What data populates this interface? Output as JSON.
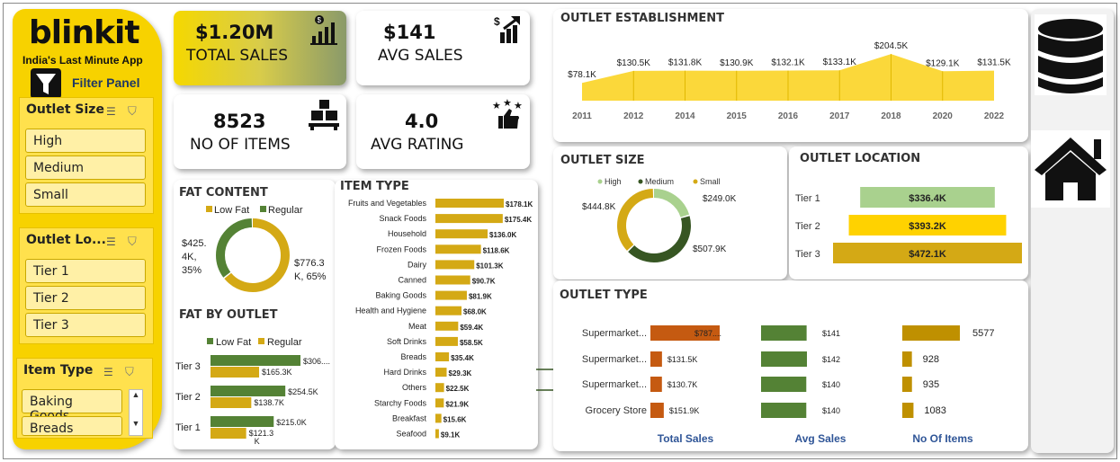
{
  "brand": {
    "logo": "blinkit",
    "tagline": "India's Last Minute App",
    "filter_panel": "Filter Panel"
  },
  "slicers": {
    "outlet_size": {
      "title": "Outlet Size",
      "items": [
        "High",
        "Medium",
        "Small"
      ]
    },
    "outlet_location": {
      "title": "Outlet Lo...",
      "items": [
        "Tier 1",
        "Tier 2",
        "Tier 3"
      ]
    },
    "item_type": {
      "title": "Item Type",
      "items": [
        "Baking Goods",
        "Breads"
      ]
    }
  },
  "kpis": {
    "total_sales": {
      "value": "$1.20M",
      "label": "TOTAL SALES"
    },
    "avg_sales": {
      "value": "$141",
      "label": "AVG SALES"
    },
    "no_of_items": {
      "value": "8523",
      "label": "NO OF ITEMS"
    },
    "avg_rating": {
      "value": "4.0",
      "label": "AVG RATING"
    }
  },
  "colors": {
    "yellow": "#f7d200",
    "gold": "#d4a915",
    "green": "#548235",
    "light_green": "#a9d18e",
    "dark_green": "#375623",
    "orange": "#c55a11",
    "dark_gold": "#bf9000"
  },
  "chart_data": [
    {
      "id": "outlet_establishment",
      "type": "area",
      "title": "OUTLET ESTABLISHMENT",
      "x": [
        "2011",
        "2012",
        "2014",
        "2015",
        "2016",
        "2017",
        "2018",
        "2020",
        "2022"
      ],
      "values": [
        78.1,
        130.5,
        131.8,
        130.9,
        132.1,
        133.1,
        204.5,
        129.1,
        131.5
      ],
      "labels": [
        "$78.1K",
        "$130.5K",
        "$131.8K",
        "$130.9K",
        "$132.1K",
        "$133.1K",
        "$204.5K",
        "$129.1K",
        "$131.5K"
      ]
    },
    {
      "id": "fat_content",
      "type": "pie",
      "title": "FAT CONTENT",
      "legend": [
        "Low Fat",
        "Regular"
      ],
      "values": [
        776.3,
        425.4
      ],
      "labels": [
        "$776.3 K, 65%",
        "$425. 4K, 35%"
      ]
    },
    {
      "id": "item_type",
      "type": "bar",
      "title": "ITEM TYPE",
      "categories": [
        "Fruits and Vegetables",
        "Snack Foods",
        "Household",
        "Frozen Foods",
        "Dairy",
        "Canned",
        "Baking Goods",
        "Health and Hygiene",
        "Meat",
        "Soft Drinks",
        "Breads",
        "Hard Drinks",
        "Others",
        "Starchy Foods",
        "Breakfast",
        "Seafood"
      ],
      "values": [
        178.1,
        175.4,
        136.0,
        118.6,
        101.3,
        90.7,
        81.9,
        68.0,
        59.4,
        58.5,
        35.4,
        29.3,
        22.5,
        21.9,
        15.6,
        9.1
      ],
      "labels": [
        "$178.1K",
        "$175.4K",
        "$136.0K",
        "$118.6K",
        "$101.3K",
        "$90.7K",
        "$81.9K",
        "$68.0K",
        "$59.4K",
        "$58.5K",
        "$35.4K",
        "$29.3K",
        "$22.5K",
        "$21.9K",
        "$15.6K",
        "$9.1K"
      ]
    },
    {
      "id": "fat_by_outlet",
      "type": "bar",
      "title": "FAT BY OUTLET",
      "categories": [
        "Tier 3",
        "Tier 2",
        "Tier 1"
      ],
      "series": [
        {
          "name": "Low Fat",
          "values": [
            306,
            254.5,
            215.0
          ],
          "labels": [
            "$306....",
            "$254.5K",
            "$215.0K"
          ]
        },
        {
          "name": "Regular",
          "values": [
            165.3,
            138.7,
            121.3
          ],
          "labels": [
            "$165.3K",
            "$138.7K",
            "$121.3 K"
          ]
        }
      ]
    },
    {
      "id": "outlet_size",
      "type": "pie",
      "title": "OUTLET SIZE",
      "legend": [
        "High",
        "Medium",
        "Small"
      ],
      "values": [
        249.0,
        507.9,
        444.8
      ],
      "labels": [
        "$249.0K",
        "$507.9K",
        "$444.8K"
      ]
    },
    {
      "id": "outlet_location",
      "type": "bar",
      "title": "OUTLET LOCATION",
      "categories": [
        "Tier 1",
        "Tier 2",
        "Tier 3"
      ],
      "values": [
        336.4,
        393.2,
        472.1
      ],
      "labels": [
        "$336.4K",
        "$393.2K",
        "$472.1K"
      ]
    },
    {
      "id": "outlet_type",
      "type": "table",
      "title": "OUTLET TYPE",
      "categories": [
        "Supermarket...",
        "Supermarket...",
        "Supermarket...",
        "Grocery Store"
      ],
      "columns": [
        "Total Sales",
        "Avg Sales",
        "No Of Items"
      ],
      "total_sales": {
        "values": [
          787,
          131.5,
          130.7,
          151.9
        ],
        "labels": [
          "$787....",
          "$131.5K",
          "$130.7K",
          "$151.9K"
        ]
      },
      "avg_sales": {
        "values": [
          141,
          142,
          140,
          140
        ],
        "labels": [
          "$141",
          "$142",
          "$140",
          "$140"
        ]
      },
      "no_of_items": {
        "values": [
          5577,
          928,
          935,
          1083
        ],
        "labels": [
          "5577",
          "928",
          "935",
          "1083"
        ]
      }
    }
  ]
}
